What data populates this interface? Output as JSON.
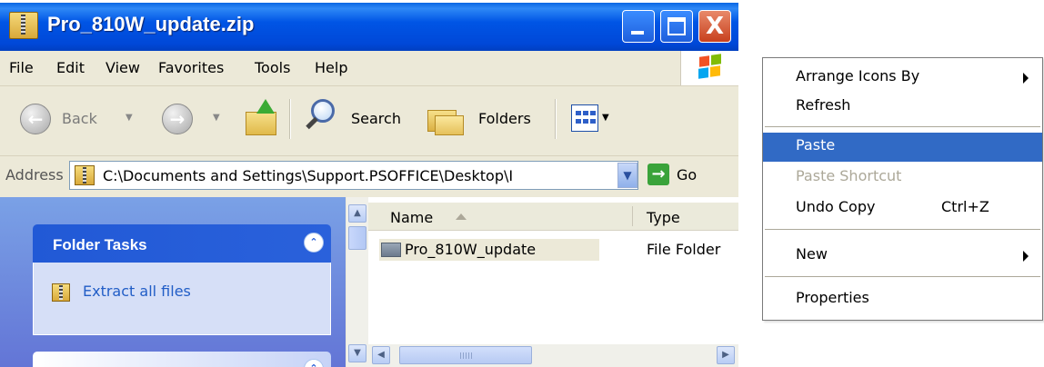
{
  "window": {
    "title": "Pro_810W_update.zip",
    "close_glyph": "X"
  },
  "menubar": [
    "File",
    "Edit",
    "View",
    "Favorites",
    "Tools",
    "Help"
  ],
  "toolbar": {
    "back_label": "Back",
    "search_label": "Search",
    "folders_label": "Folders"
  },
  "address": {
    "label": "Address",
    "value": "C:\\Documents and Settings\\Support.PSOFFICE\\Desktop\\I",
    "go_label": "Go"
  },
  "task_pane": {
    "header": "Folder Tasks",
    "link": "Extract all files"
  },
  "file_list": {
    "columns": [
      "Name",
      "Type"
    ],
    "rows": [
      {
        "name": "Pro_810W_update",
        "type": "File Folder"
      }
    ]
  },
  "context_menu": {
    "items": [
      {
        "label": "Arrange Icons By",
        "submenu": true
      },
      {
        "label": "Refresh"
      },
      {
        "label": "Paste",
        "highlighted": true
      },
      {
        "label": "Paste Shortcut",
        "disabled": true
      },
      {
        "label": "Undo Copy",
        "shortcut": "Ctrl+Z"
      },
      {
        "label": "New",
        "submenu": true
      },
      {
        "label": "Properties"
      }
    ]
  },
  "colors": {
    "title_blue": "#0055e5",
    "menu_highlight": "#316ac5",
    "task_pane_blue": "#6375d6",
    "link_blue": "#215dc6"
  }
}
